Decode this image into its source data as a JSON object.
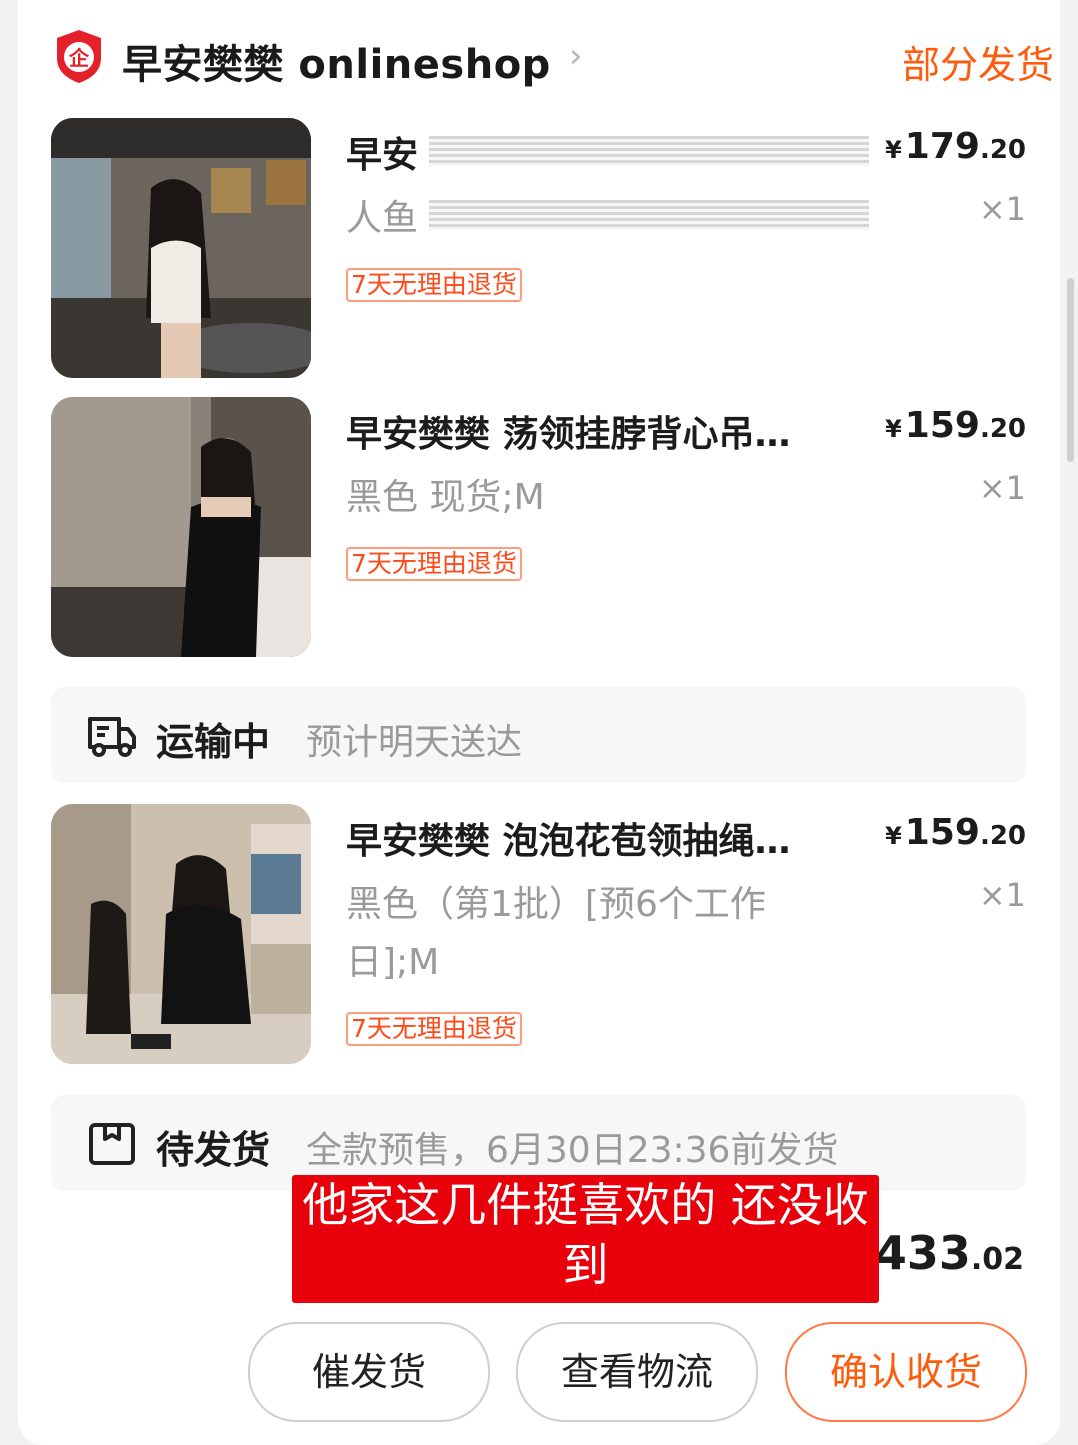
{
  "shop": {
    "name": "早安樊樊 onlineshop",
    "chevron": "›",
    "order_status": "部分发货",
    "logo_text": "企"
  },
  "items": [
    {
      "title": "早安",
      "variant": "人鱼",
      "price_int": "179",
      "price_dec": ".20",
      "qty": "×1",
      "tag": "7天无理由退货"
    },
    {
      "title": "早安樊樊 荡领挂脖背心吊…",
      "variant": "黑色 现货;M",
      "price_int": "159",
      "price_dec": ".20",
      "qty": "×1",
      "tag": "7天无理由退货"
    },
    {
      "title": "早安樊樊 泡泡花苞领抽绳…",
      "variant": "黑色（第1批）[预6个工作日];M",
      "price_int": "159",
      "price_dec": ".20",
      "qty": "×1",
      "tag": "7天无理由退货"
    }
  ],
  "currency": "¥",
  "shipping_in_transit": {
    "label": "运输中",
    "desc": "预计明天送达",
    "icon": "truck-icon"
  },
  "shipping_pending": {
    "label": "待发货",
    "desc": "全款预售，6月30日23:36前发货",
    "icon": "box-icon"
  },
  "total": {
    "int": "433",
    "dec": ".02"
  },
  "overlay_caption": "他家这几件挺喜欢的 还没收到",
  "buttons": {
    "urge": "催发货",
    "logistics": "查看物流",
    "confirm": "确认收货"
  },
  "colors": {
    "accent": "#ff5b0d",
    "caption_bg": "#e8000b",
    "muted": "#9a9a9a"
  }
}
